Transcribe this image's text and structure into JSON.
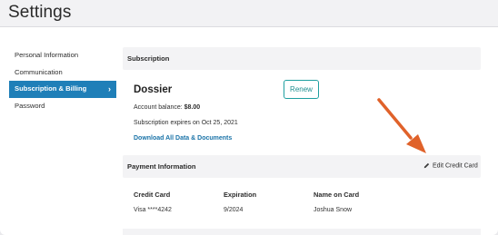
{
  "header": {
    "title": "Settings"
  },
  "sidebar": {
    "items": [
      {
        "label": "Personal Information"
      },
      {
        "label": "Communication"
      },
      {
        "label": "Subscription & Billing",
        "chevron": "›"
      },
      {
        "label": "Password"
      }
    ]
  },
  "subscription": {
    "section_label": "Subscription",
    "plan_name": "Dossier",
    "renew_label": "Renew",
    "balance_label": "Account balance: ",
    "balance_value": "$8.00",
    "expires_text": "Subscription expires on Oct 25, 2021",
    "download_link": "Download All Data & Documents"
  },
  "payment": {
    "section_label": "Payment Information",
    "edit_label": "Edit Credit Card",
    "columns": [
      {
        "header": "Credit Card",
        "value": "Visa ****4242"
      },
      {
        "header": "Expiration",
        "value": "9/2024"
      },
      {
        "header": "Name on Card",
        "value": "Joshua Snow"
      }
    ]
  },
  "colors": {
    "accent": "#1f7fb8",
    "arrow": "#e0622a",
    "renew": "#1f9fa0"
  },
  "icons": {
    "edit": "pencil-icon",
    "active_chevron": "chevron-right-icon",
    "annotation": "arrow-annotation"
  }
}
